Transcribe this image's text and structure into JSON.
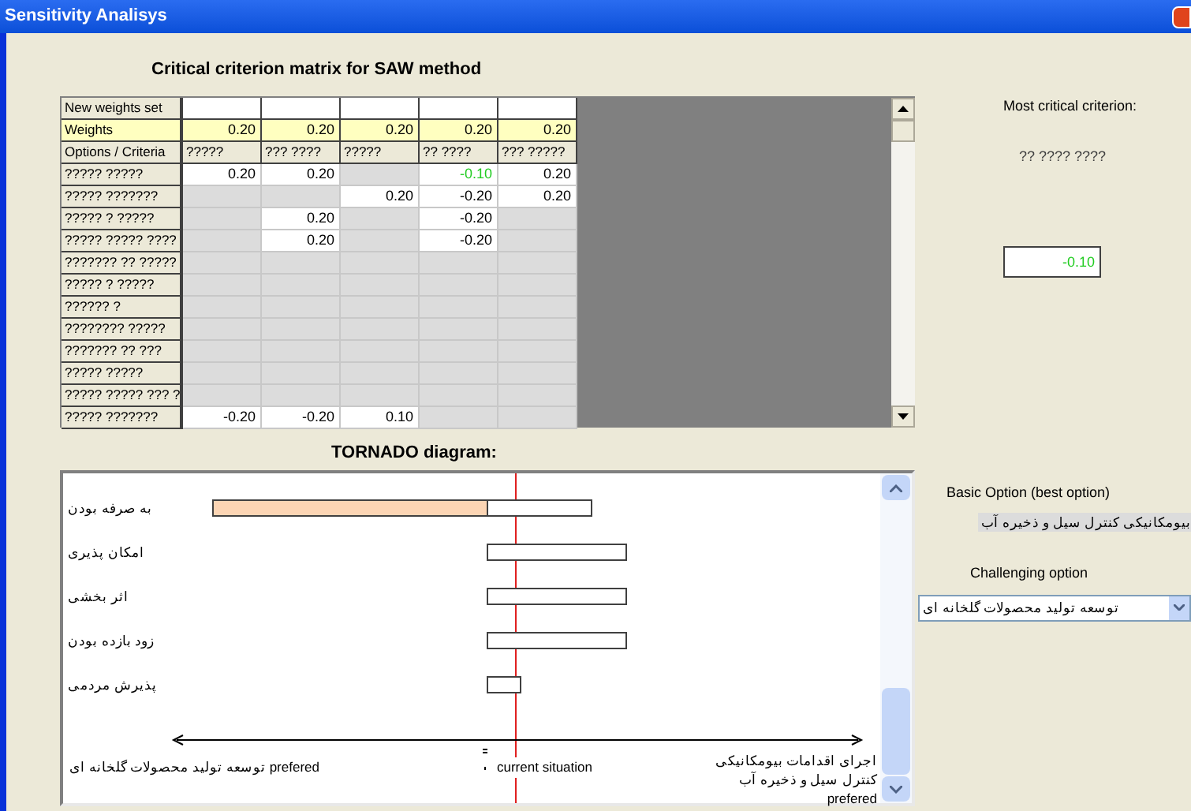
{
  "window": {
    "title": "Sensitivity Analisys"
  },
  "matrix": {
    "title": "Critical criterion matrix for SAW method",
    "new_weights_label": "New weights set",
    "weights_label": "Weights",
    "weights": [
      "0.20",
      "0.20",
      "0.20",
      "0.20",
      "0.20"
    ],
    "criteria_label": "Options / Criteria",
    "criteria": [
      "?????",
      "??? ????",
      "?????",
      "?? ????",
      "??? ?????"
    ],
    "rows": [
      {
        "label": "????? ?????",
        "cells": [
          {
            "active": true,
            "critical": false,
            "value": "0.20"
          },
          {
            "active": true,
            "critical": false,
            "value": "0.20"
          },
          {
            "active": false
          },
          {
            "active": true,
            "critical": true,
            "value": "-0.10"
          },
          {
            "active": true,
            "critical": false,
            "value": "0.20"
          }
        ]
      },
      {
        "label": "????? ???????",
        "cells": [
          {
            "active": false
          },
          {
            "active": false
          },
          {
            "active": true,
            "critical": false,
            "value": "0.20"
          },
          {
            "active": true,
            "critical": false,
            "value": "-0.20"
          },
          {
            "active": true,
            "critical": false,
            "value": "0.20"
          }
        ]
      },
      {
        "label": "????? ? ?????",
        "cells": [
          {
            "active": false
          },
          {
            "active": true,
            "critical": false,
            "value": "0.20"
          },
          {
            "active": false
          },
          {
            "active": true,
            "critical": false,
            "value": "-0.20"
          },
          {
            "active": false
          }
        ]
      },
      {
        "label": "????? ????? ????",
        "cells": [
          {
            "active": false
          },
          {
            "active": true,
            "critical": false,
            "value": "0.20"
          },
          {
            "active": false
          },
          {
            "active": true,
            "critical": false,
            "value": "-0.20"
          },
          {
            "active": false
          }
        ]
      },
      {
        "label": "??????? ?? ?????",
        "cells": [
          {
            "active": false
          },
          {
            "active": false
          },
          {
            "active": false
          },
          {
            "active": false
          },
          {
            "active": false
          }
        ]
      },
      {
        "label": "????? ? ?????",
        "cells": [
          {
            "active": false
          },
          {
            "active": false
          },
          {
            "active": false
          },
          {
            "active": false
          },
          {
            "active": false
          }
        ]
      },
      {
        "label": "?????? ?",
        "cells": [
          {
            "active": false
          },
          {
            "active": false
          },
          {
            "active": false
          },
          {
            "active": false
          },
          {
            "active": false
          }
        ]
      },
      {
        "label": "???????? ?????",
        "cells": [
          {
            "active": false
          },
          {
            "active": false
          },
          {
            "active": false
          },
          {
            "active": false
          },
          {
            "active": false
          }
        ]
      },
      {
        "label": "??????? ?? ???",
        "cells": [
          {
            "active": false
          },
          {
            "active": false
          },
          {
            "active": false
          },
          {
            "active": false
          },
          {
            "active": false
          }
        ]
      },
      {
        "label": "????? ?????",
        "cells": [
          {
            "active": false
          },
          {
            "active": false
          },
          {
            "active": false
          },
          {
            "active": false
          },
          {
            "active": false
          }
        ]
      },
      {
        "label": "????? ????? ??? ?",
        "cells": [
          {
            "active": false
          },
          {
            "active": false
          },
          {
            "active": false
          },
          {
            "active": false
          },
          {
            "active": false
          }
        ]
      },
      {
        "label": "????? ???????",
        "cells": [
          {
            "active": true,
            "critical": false,
            "value": "-0.20"
          },
          {
            "active": true,
            "critical": false,
            "value": "-0.20"
          },
          {
            "active": true,
            "critical": false,
            "value": "0.10"
          },
          {
            "active": false
          },
          {
            "active": false
          }
        ]
      }
    ]
  },
  "tornado": {
    "title": "TORNADO diagram:",
    "criteria": [
      {
        "label": "به صرفه بودن"
      },
      {
        "label": "امکان پذیری"
      },
      {
        "label": "اثر بخشی"
      },
      {
        "label": "زود بازده بودن"
      },
      {
        "label": "پذیرش مردمی"
      }
    ],
    "left_note": "توسعه تولید محصولات گلخانه ای prefered",
    "center_note": "current situation",
    "right_note": "اجرای اقدامات بیومکانیکی کنترل سیل و ذخیره آب prefered"
  },
  "most_critical": {
    "label": "Most critical criterion:",
    "criterion": "?? ???? ????",
    "value": "-0.10"
  },
  "basic_option": {
    "label": "Basic Option (best option)",
    "value": "بیومکانیکی کنترل سیل و ذخیره آب"
  },
  "challenging_option": {
    "label": "Challenging option",
    "value": "توسعه تولید محصولات گلخانه ای"
  }
}
